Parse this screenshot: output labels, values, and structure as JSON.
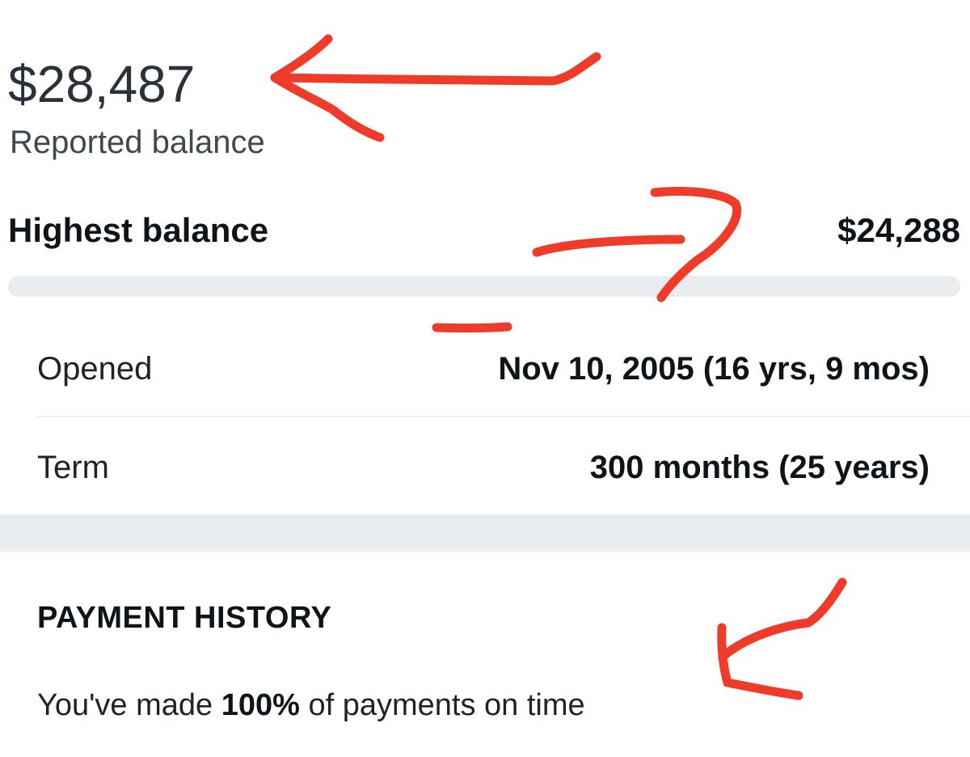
{
  "balance": {
    "amount": "$28,487",
    "label": "Reported balance"
  },
  "highest": {
    "label": "Highest balance",
    "value": "$24,288"
  },
  "details": [
    {
      "label": "Opened",
      "value": "Nov 10, 2005 (16 yrs, 9 mos)"
    },
    {
      "label": "Term",
      "value": "300 months (25 years)"
    }
  ],
  "payment_history": {
    "title": "PAYMENT HISTORY",
    "text_before": "You've made ",
    "percent": "100%",
    "text_after": " of payments on time"
  },
  "colors": {
    "annotation": "#ee3b2a",
    "track": "#e9edf0",
    "text": "#1d2329"
  }
}
